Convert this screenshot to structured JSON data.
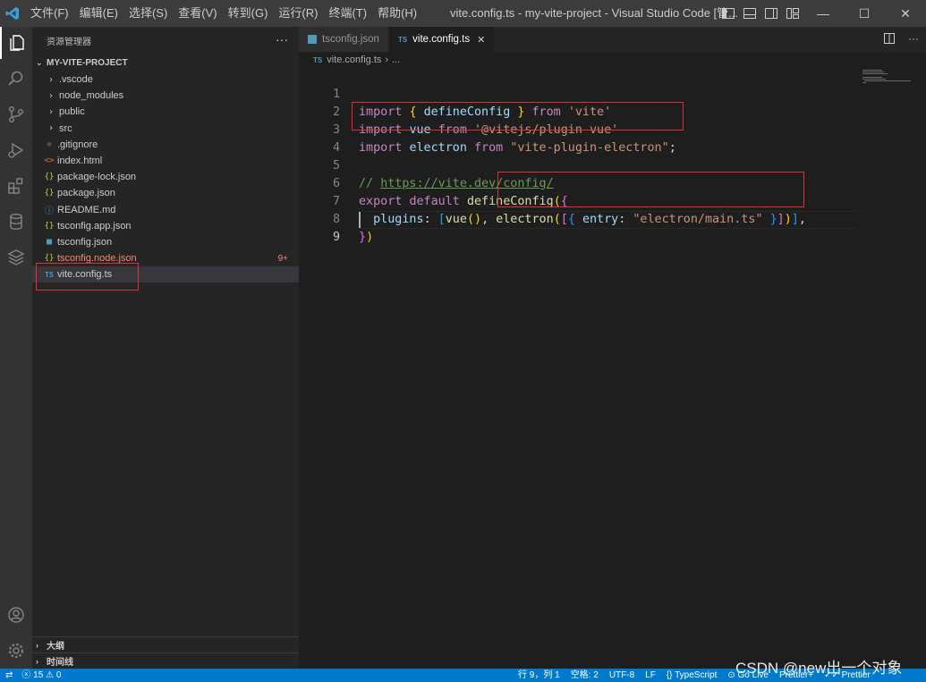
{
  "titlebar": {
    "menu": [
      "文件(F)",
      "编辑(E)",
      "选择(S)",
      "查看(V)",
      "转到(G)",
      "运行(R)",
      "终端(T)",
      "帮助(H)"
    ],
    "title": "vite.config.ts - my-vite-project - Visual Studio Code [管...",
    "minimize": "—",
    "maximize": "☐",
    "close": "✕"
  },
  "sidebar": {
    "header": "资源管理器",
    "more": "···",
    "project": "MY-VITE-PROJECT",
    "items": [
      {
        "label": ".vscode",
        "type": "folder",
        "icon": "chevron-right"
      },
      {
        "label": "node_modules",
        "type": "folder",
        "icon": "chevron-right"
      },
      {
        "label": "public",
        "type": "folder",
        "icon": "chevron-right"
      },
      {
        "label": "src",
        "type": "folder",
        "icon": "chevron-right"
      },
      {
        "label": ".gitignore",
        "type": "file",
        "icon": "git-icon"
      },
      {
        "label": "index.html",
        "type": "file",
        "icon": "html-icon"
      },
      {
        "label": "package-lock.json",
        "type": "file",
        "icon": "json-icon"
      },
      {
        "label": "package.json",
        "type": "file",
        "icon": "json-icon"
      },
      {
        "label": "README.md",
        "type": "file",
        "icon": "info-icon"
      },
      {
        "label": "tsconfig.app.json",
        "type": "file",
        "icon": "json-icon"
      },
      {
        "label": "tsconfig.json",
        "type": "file",
        "icon": "tsconfig-icon"
      },
      {
        "label": "tsconfig.node.json",
        "type": "file",
        "icon": "json-icon",
        "badge": "9+",
        "color": "#f48771"
      },
      {
        "label": "vite.config.ts",
        "type": "file",
        "icon": "ts-icon",
        "selected": true
      }
    ],
    "outline": "大纲",
    "timeline": "时间线"
  },
  "tabs": [
    {
      "label": "tsconfig.json",
      "active": false
    },
    {
      "label": "vite.config.ts",
      "active": true,
      "close": "✕"
    }
  ],
  "breadcrumb": {
    "file": "vite.config.ts",
    "sep": "›",
    "more": "..."
  },
  "editor": {
    "line_numbers": [
      "1",
      "2",
      "3",
      "4",
      "5",
      "6",
      "7",
      "8",
      "9"
    ],
    "current_line": "9"
  },
  "statusbar": {
    "errors": "15",
    "warnings": "0",
    "position": "行 9，列 1",
    "spaces": "空格: 2",
    "encoding": "UTF-8",
    "eol": "LF",
    "language": "TypeScript",
    "golive": "Go Live",
    "prettier_plus": "Prettier+",
    "prettier": "Prettier"
  },
  "watermark": "CSDN @new出一个对象",
  "colors": {
    "accent": "#007acc",
    "highlight_box": "#e03030"
  }
}
